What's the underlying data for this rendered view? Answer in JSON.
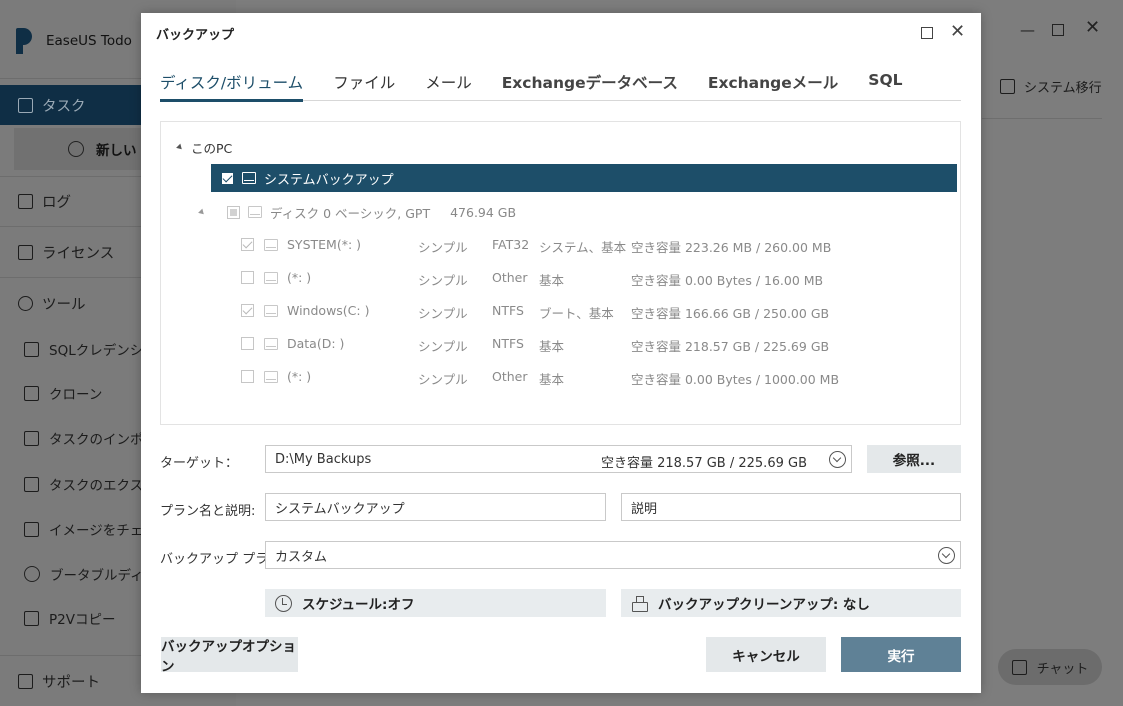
{
  "app": {
    "title": "EaseUS Todo",
    "nav": {
      "task": "タスク",
      "new_label": "新しい",
      "log": "ログ",
      "license": "ライセンス",
      "tools": "ツール",
      "tools_items": [
        "SQLクレデンシャ",
        "クローン",
        "タスクのインポー",
        "タスクのエクスポ",
        "イメージをチェック",
        "ブータブルディスク",
        "P2Vコピー"
      ],
      "support": "サポート"
    },
    "system_transfer": "システム移行",
    "chat": "チャット"
  },
  "dialog": {
    "title": "バックアップ",
    "tabs": [
      "ディスク/ボリューム",
      "ファイル",
      "メール",
      "Exchangeデータベース",
      "Exchangeメール",
      "SQL"
    ],
    "tree": {
      "root": "このPC",
      "selected": "システムバックアップ",
      "disk": {
        "name": "ディスク 0 ベーシック, GPT",
        "size": "476.94 GB"
      },
      "partitions": [
        {
          "name": "SYSTEM(*: )",
          "type": "シンプル",
          "fs": "FAT32",
          "flags": "システム、基本",
          "space": "空き容量 223.26 MB / 260.00 MB",
          "checked": true
        },
        {
          "name": "(*: )",
          "type": "シンプル",
          "fs": "Other",
          "flags": "基本",
          "space": "空き容量 0.00 Bytes / 16.00 MB",
          "checked": false
        },
        {
          "name": "Windows(C: )",
          "type": "シンプル",
          "fs": "NTFS",
          "flags": "ブート、基本",
          "space": "空き容量 166.66 GB / 250.00 GB",
          "checked": true
        },
        {
          "name": "Data(D: )",
          "type": "シンプル",
          "fs": "NTFS",
          "flags": "基本",
          "space": "空き容量 218.57 GB / 225.69 GB",
          "checked": false
        },
        {
          "name": "(*: )",
          "type": "シンプル",
          "fs": "Other",
          "flags": "基本",
          "space": "空き容量 0.00 Bytes / 1000.00 MB",
          "checked": false
        }
      ]
    },
    "target": {
      "label": "ターゲット：",
      "path": "D:\\My Backups",
      "space": "空き容量 218.57 GB / 225.69 GB",
      "browse": "参照..."
    },
    "plan": {
      "label": "プラン名と説明:",
      "name": "システムバックアップ",
      "desc": "説明"
    },
    "backup_plan": {
      "label": "バックアップ プラン:",
      "value": "カスタム"
    },
    "schedule": "スケジュール:オフ",
    "cleanup": "バックアップクリーンアップ: なし",
    "options_btn": "バックアップオプション",
    "cancel_btn": "キャンセル",
    "run_btn": "実行"
  }
}
